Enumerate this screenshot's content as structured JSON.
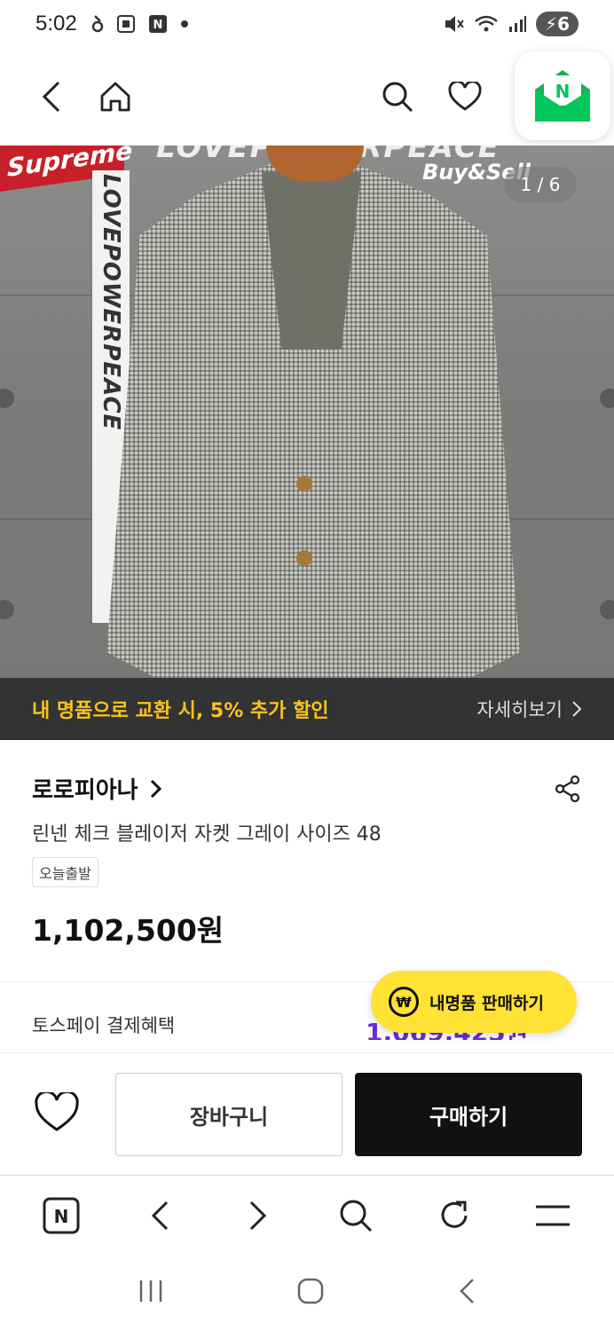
{
  "status_bar": {
    "time": "5:02",
    "battery": "6"
  },
  "top_nav": {
    "back_icon": "chevron-left-icon",
    "home_icon": "home-icon",
    "search_icon": "search-icon",
    "wishlist_icon": "heart-icon",
    "mail_icon": "naver-mail-icon"
  },
  "hero": {
    "counter": "1 / 6",
    "promo_text": "내 명품으로 교환 시, 5% 추가 할인",
    "promo_more": "자세히보기",
    "sign_supreme": "Supreme",
    "sign_love_top": "LOVEPOWERPEACE",
    "sign_buysell": "Buy&Sell",
    "sign_love_vertical": "LOVEPOWERPEACE"
  },
  "product": {
    "brand": "로로피아나",
    "name": "린넨 체크 블레이저 자켓 그레이 사이즈 48",
    "tag": "오늘출발",
    "price": "1,102,500원"
  },
  "payment": {
    "label": "토스페이 결제혜택",
    "value": "1,069,425원"
  },
  "sell_fab": {
    "icon_text": "₩",
    "label": "내명품 판매하기"
  },
  "action_bar": {
    "cart_label": "장바구니",
    "buy_label": "구매하기"
  },
  "colors": {
    "accent_purple": "#6a2bd9",
    "promo_yellow": "#ffc21a",
    "fab_yellow": "#ffe234",
    "buy_black": "#111111",
    "naver_green": "#03c75a"
  }
}
